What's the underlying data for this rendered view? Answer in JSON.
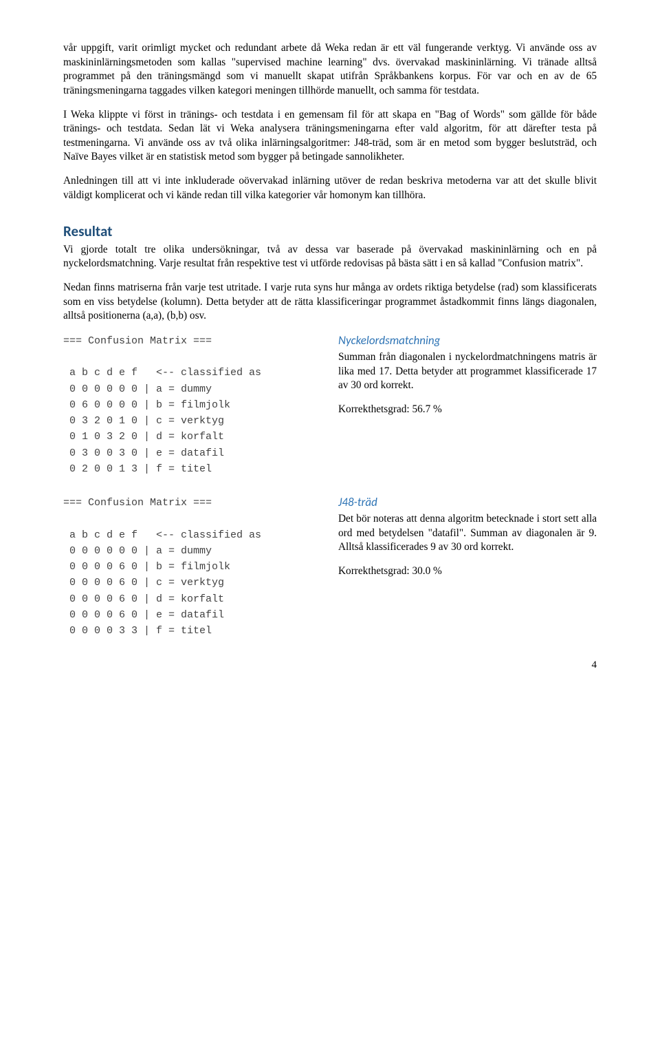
{
  "paragraphs": {
    "p1": "vår uppgift, varit orimligt mycket och redundant arbete då Weka redan är ett väl fungerande verktyg. Vi använde oss av maskininlärningsmetoden som kallas \"supervised machine learning\" dvs. övervakad maskininlärning. Vi tränade alltså programmet på den tränings­mängd som vi manuellt skapat utifrån Språkbankens korpus. För var och en av de 65 träningsmeningarna taggades vilken kategori meningen tillhörde manuellt, och samma för testdata.",
    "p2": "I Weka klippte vi först in tränings- och testdata i en gemensam fil för att skapa en \"Bag of Words\" som gällde för både tränings- och testdata. Sedan lät vi Weka analysera tränings­meningarna efter vald algoritm, för att därefter testa på testmeningarna. Vi använde oss av två olika inlärningsalgoritmer: J48-träd, som är en metod som bygger beslutsträd, och Naïve Bayes vilket är en statistisk metod som bygger på betingade sannolikheter.",
    "p3": "Anledningen till att vi inte inkluderade oövervakad inlärning utöver de redan beskriva metoderna var att det skulle blivit väldigt komplicerat och vi kände redan till vilka kategorier vår homonym kan tillhöra.",
    "results_title": "Resultat",
    "p4": "Vi gjorde totalt tre olika undersökningar, två av dessa var baserade på övervakad maskininlärning och en på nyckelordsmatchning. Varje resultat från respektive test vi utförde redovisas på bästa sätt i en så kallad \"Confusion matrix\".",
    "p5": "Nedan finns matriserna från varje test utritade. I varje ruta syns hur många av ordets riktiga betydelse (rad) som klassificerats som en viss betydelse (kolumn). Detta betyder att de rätta klassificeringar programmet åstadkommit finns längs diagonalen, alltså positionerna (a,a), (b,b) osv."
  },
  "confusion1": {
    "header": "=== Confusion Matrix ===",
    "cols": " a b c d e f   <-- classified as",
    "rows": [
      " 0 0 0 0 0 0 | a = dummy",
      " 0 6 0 0 0 0 | b = filmjolk",
      " 0 3 2 0 1 0 | c = verktyg",
      " 0 1 0 3 2 0 | d = korfalt",
      " 0 3 0 0 3 0 | e = datafil",
      " 0 2 0 0 1 3 | f = titel"
    ]
  },
  "confusion2": {
    "header": "=== Confusion Matrix ===",
    "cols": " a b c d e f   <-- classified as",
    "rows": [
      " 0 0 0 0 0 0 | a = dummy",
      " 0 0 0 0 6 0 | b = filmjolk",
      " 0 0 0 0 6 0 | c = verktyg",
      " 0 0 0 0 6 0 | d = korfalt",
      " 0 0 0 0 6 0 | e = datafil",
      " 0 0 0 0 3 3 | f = titel"
    ]
  },
  "keyword": {
    "title": "Nyckelordsmatchning",
    "p1": "Summan från diagonalen i nyckelord­matchningens matris är lika med 17. Detta betyder att programmet klassificerade 17 av 30 ord korrekt.",
    "p2": "Korrekthetsgrad: 56.7 %"
  },
  "j48": {
    "title": "J48-träd",
    "p1": "Det bör noteras att denna algoritm betecknade i stort sett alla ord med betydelsen \"datafil\". Summan av diagon­alen är 9. Alltså klassificerades 9 av 30 ord korrekt.",
    "p2": "Korrekthetsgrad: 30.0 %"
  },
  "page_number": "4"
}
